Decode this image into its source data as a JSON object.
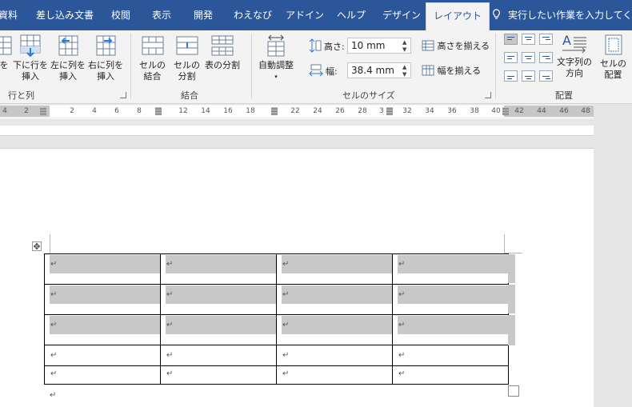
{
  "tabs": [
    {
      "label": "資料"
    },
    {
      "label": "差し込み文書"
    },
    {
      "label": "校閲"
    },
    {
      "label": "表示"
    },
    {
      "label": "開発"
    },
    {
      "label": "わえなび"
    },
    {
      "label": "アドイン"
    },
    {
      "label": "ヘルプ"
    },
    {
      "label": "デザイン"
    },
    {
      "label": "レイアウト"
    }
  ],
  "tell_me": "実行したい作業を入力してくださ",
  "groups": {
    "rows_cols": {
      "label": "行と列",
      "buttons": [
        {
          "l1": "を",
          "l2": ""
        },
        {
          "l1": "下に行を",
          "l2": "挿入"
        },
        {
          "l1": "左に列を",
          "l2": "挿入"
        },
        {
          "l1": "右に列を",
          "l2": "挿入"
        }
      ]
    },
    "merge": {
      "label": "結合",
      "buttons": [
        {
          "l1": "セルの",
          "l2": "結合"
        },
        {
          "l1": "セルの",
          "l2": "分割"
        },
        {
          "l1": "表の分割",
          "l2": ""
        }
      ]
    },
    "cell_size": {
      "label": "セルのサイズ",
      "autofit": "自動調整",
      "height_label": "高さ:",
      "height_value": "10 mm",
      "width_label": "幅:",
      "width_value": "38.4 mm",
      "distribute_rows": "高さを揃える",
      "distribute_cols": "幅を揃える"
    },
    "alignment": {
      "label": "配置",
      "text_direction": {
        "l1": "文字列の",
        "l2": "方向"
      },
      "cell_margins": {
        "l1": "セルの",
        "l2": "配置"
      }
    }
  },
  "ruler": {
    "left_ticks": [
      "4",
      "2"
    ],
    "ticks": [
      "2",
      "4",
      "6",
      "8",
      "12",
      "14",
      "16",
      "18",
      "22",
      "24",
      "26",
      "28",
      "3",
      "32",
      "34",
      "36",
      "38",
      "40",
      "42",
      "44",
      "46",
      "48"
    ]
  },
  "table": {
    "rows": 5,
    "cols": 4,
    "cell_mark": "↵",
    "highlighted_rows": 3
  },
  "colors": {
    "ribbon_blue": "#2b579a",
    "ribbon_bg": "#f3f3f3",
    "row_shade": "#c8c8c8"
  }
}
